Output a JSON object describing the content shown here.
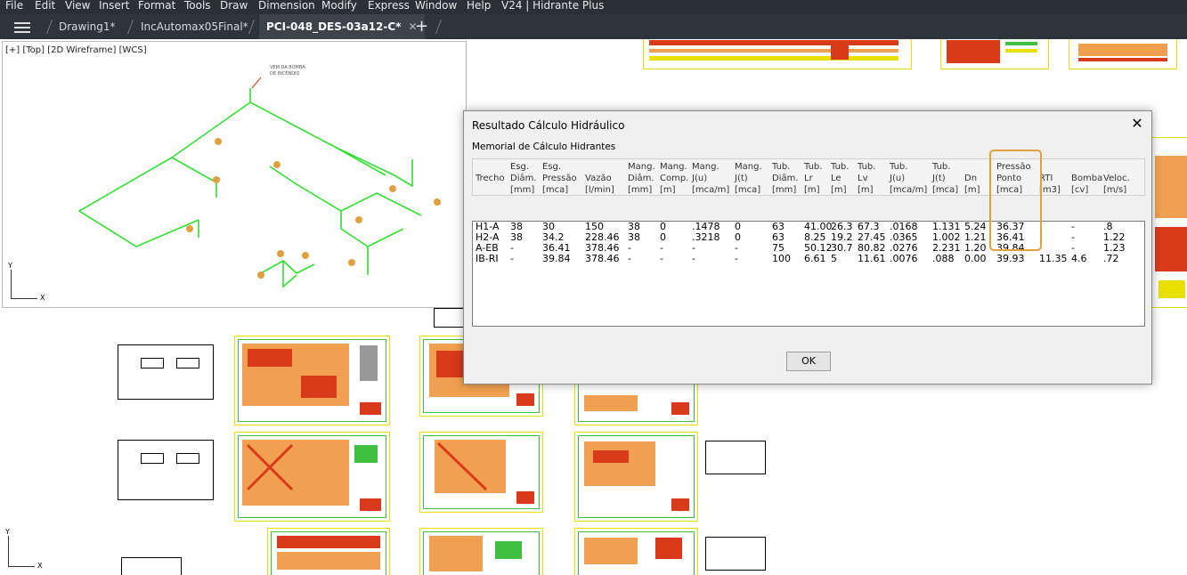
{
  "menu": [
    "File",
    "Edit",
    "View",
    "Insert",
    "Format",
    "Tools",
    "Draw",
    "Dimension",
    "Modify",
    "Express",
    "Window",
    "Help",
    "V24 | Hidrante Plus"
  ],
  "tabs": [
    "Drawing1*",
    "IncAutomax05Final*",
    "PCI-048_DES-03a12-C*"
  ],
  "active_tab": 2,
  "viewport": {
    "label": "[+] [Top] [2D Wireframe] [WCS]",
    "axis_x": "X",
    "axis_y": "Y"
  },
  "ucs2": {
    "axis_x": "X",
    "axis_y": "Y"
  },
  "dialog": {
    "title": "Resultado Cálculo Hidráulico",
    "close_glyph": "✕",
    "subtitle": "Memorial de Cálculo Hidrantes",
    "ok_label": "OK",
    "headers": [
      {
        "key": "trecho",
        "lines": [
          "Trecho"
        ]
      },
      {
        "key": "esg_diam",
        "lines": [
          "Esg.",
          "Diâm.",
          "[mm]"
        ]
      },
      {
        "key": "esg_pressao",
        "lines": [
          "Esg.",
          "Pressão",
          "[mca]"
        ]
      },
      {
        "key": "vazao",
        "lines": [
          "Vazão",
          "[l/min]"
        ]
      },
      {
        "key": "mang_diam",
        "lines": [
          "Mang.",
          "Diâm.",
          "[mm]"
        ]
      },
      {
        "key": "mang_comp",
        "lines": [
          "Mang.",
          "Comp.",
          "[m]"
        ]
      },
      {
        "key": "mang_ju",
        "lines": [
          "Mang.",
          "J(u)",
          "[mca/m]"
        ]
      },
      {
        "key": "mang_jt",
        "lines": [
          "Mang.",
          "J(t)",
          "[mca]"
        ]
      },
      {
        "key": "tub_diam",
        "lines": [
          "Tub.",
          "Diâm.",
          "[mm]"
        ]
      },
      {
        "key": "tub_lr",
        "lines": [
          "Tub.",
          "Lr",
          "[m]"
        ]
      },
      {
        "key": "tub_le",
        "lines": [
          "Tub.",
          "Le",
          "[m]"
        ]
      },
      {
        "key": "tub_lv",
        "lines": [
          "Tub.",
          "Lv",
          "[m]"
        ]
      },
      {
        "key": "tub_ju",
        "lines": [
          "Tub.",
          "J(u)",
          "[mca/m]"
        ]
      },
      {
        "key": "tub_jt",
        "lines": [
          "Tub.",
          "J(t)",
          "[mca]"
        ]
      },
      {
        "key": "dn",
        "lines": [
          "Dn",
          "[m]"
        ]
      },
      {
        "key": "pressao_ponto",
        "lines": [
          "Pressão",
          "Ponto",
          "[mca]"
        ]
      },
      {
        "key": "rti",
        "lines": [
          "RTI",
          "[m3]"
        ]
      },
      {
        "key": "bomba",
        "lines": [
          "Bomba",
          "[cv]"
        ]
      },
      {
        "key": "veloc",
        "lines": [
          "Veloc.",
          "[m/s]"
        ]
      }
    ],
    "rows": [
      [
        "H1-A",
        "38",
        "30",
        "150",
        "38",
        "0",
        ".1478",
        "0",
        "63",
        "41.00",
        "26.3",
        "67.3",
        ".0168",
        "1.131",
        "5.24",
        "36.37",
        "",
        "-",
        ".8"
      ],
      [
        "H2-A",
        "38",
        "34.2",
        "228.46",
        "38",
        "0",
        ".3218",
        "0",
        "63",
        "8.25",
        "19.2",
        "27.45",
        ".0365",
        "1.002",
        "1.21",
        "36.41",
        "",
        "-",
        "1.22"
      ],
      [
        "A-EB",
        "-",
        "36.41",
        "378.46",
        "-",
        "-",
        "-",
        "-",
        "75",
        "50.12",
        "30.7",
        "80.82",
        ".0276",
        "2.231",
        "1.20",
        "39.84",
        "",
        "-",
        "1.23"
      ],
      [
        "IB-RI",
        "-",
        "39.84",
        "378.46",
        "-",
        "-",
        "-",
        "-",
        "100",
        "6.61",
        "5",
        "11.61",
        ".0076",
        ".088",
        "0.00",
        "39.93",
        "11.35",
        "4.6",
        ".72"
      ]
    ],
    "highlight_color": "#e0a23a"
  },
  "colors": {
    "menubar_bg": "#2b3036",
    "tab_active_bg": "#3d434b",
    "pipe": "#33dd33",
    "sheet_border": "#e8e000",
    "sheet_red": "#d83a1a",
    "sheet_orange": "#f0a050"
  }
}
